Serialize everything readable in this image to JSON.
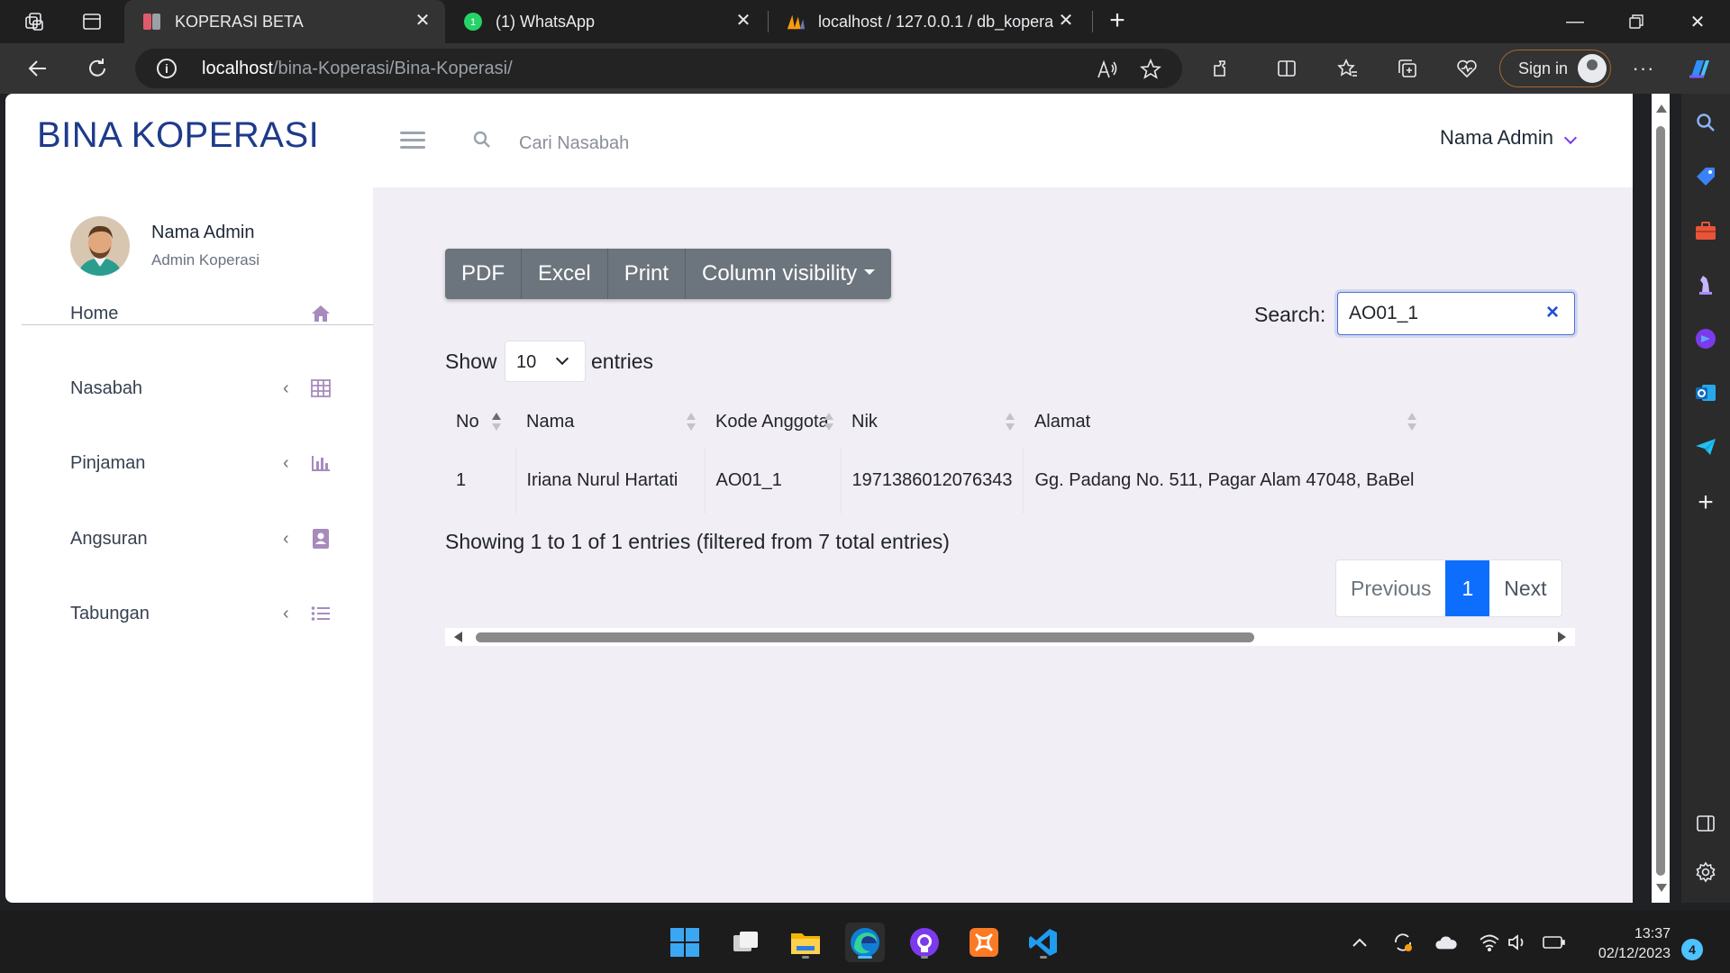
{
  "browser": {
    "tabs": [
      {
        "title": "KOPERASI BETA",
        "active": true
      },
      {
        "title": "(1) WhatsApp",
        "active": false
      },
      {
        "title": "localhost / 127.0.0.1 / db_kopera",
        "active": false
      }
    ],
    "url_host": "localhost",
    "url_path": "/bina-Koperasi/Bina-Koperasi/",
    "sign_in_label": "Sign in"
  },
  "app": {
    "brand": "BINA KOPERASI",
    "top_search_placeholder": "Cari Nasabah",
    "admin_menu_label": "Nama Admin"
  },
  "profile": {
    "name": "Nama Admin",
    "role": "Admin Koperasi"
  },
  "sidebar": {
    "items": [
      {
        "label": "Home",
        "icon": "home-icon",
        "has_arrow": false
      },
      {
        "label": "Nasabah",
        "icon": "table-icon",
        "has_arrow": true
      },
      {
        "label": "Pinjaman",
        "icon": "bar-chart-icon",
        "has_arrow": true
      },
      {
        "label": "Angsuran",
        "icon": "contact-book-icon",
        "has_arrow": true
      },
      {
        "label": "Tabungan",
        "icon": "list-icon",
        "has_arrow": true
      }
    ]
  },
  "toolbar": {
    "pdf": "PDF",
    "excel": "Excel",
    "print": "Print",
    "column_visibility": "Column visibility"
  },
  "datatable": {
    "search_label": "Search:",
    "search_value": "AO01_1",
    "show_label": "Show",
    "length_value": "10",
    "entries_label": "entries",
    "columns": [
      "No",
      "Nama",
      "Kode Anggota",
      "Nik",
      "Alamat"
    ],
    "rows": [
      [
        "1",
        "Iriana Nurul Hartati",
        "AO01_1",
        "1971386012076343",
        "Gg. Padang No. 511, Pagar Alam 47048, BaBel"
      ]
    ],
    "info": "Showing 1 to 1 of 1 entries (filtered from 7 total entries)",
    "pagination": {
      "previous": "Previous",
      "current": "1",
      "next": "Next"
    }
  },
  "taskbar": {
    "time": "13:37",
    "date": "02/12/2023",
    "notification_count": "4"
  },
  "colors": {
    "brand": "#1e3a8a",
    "accent_purple": "#7c3aed",
    "sidebar_icon": "#a78bbd",
    "content_bg": "#f1eef5",
    "button_gray": "#6c757d",
    "pagination_active": "#0d6efd"
  }
}
